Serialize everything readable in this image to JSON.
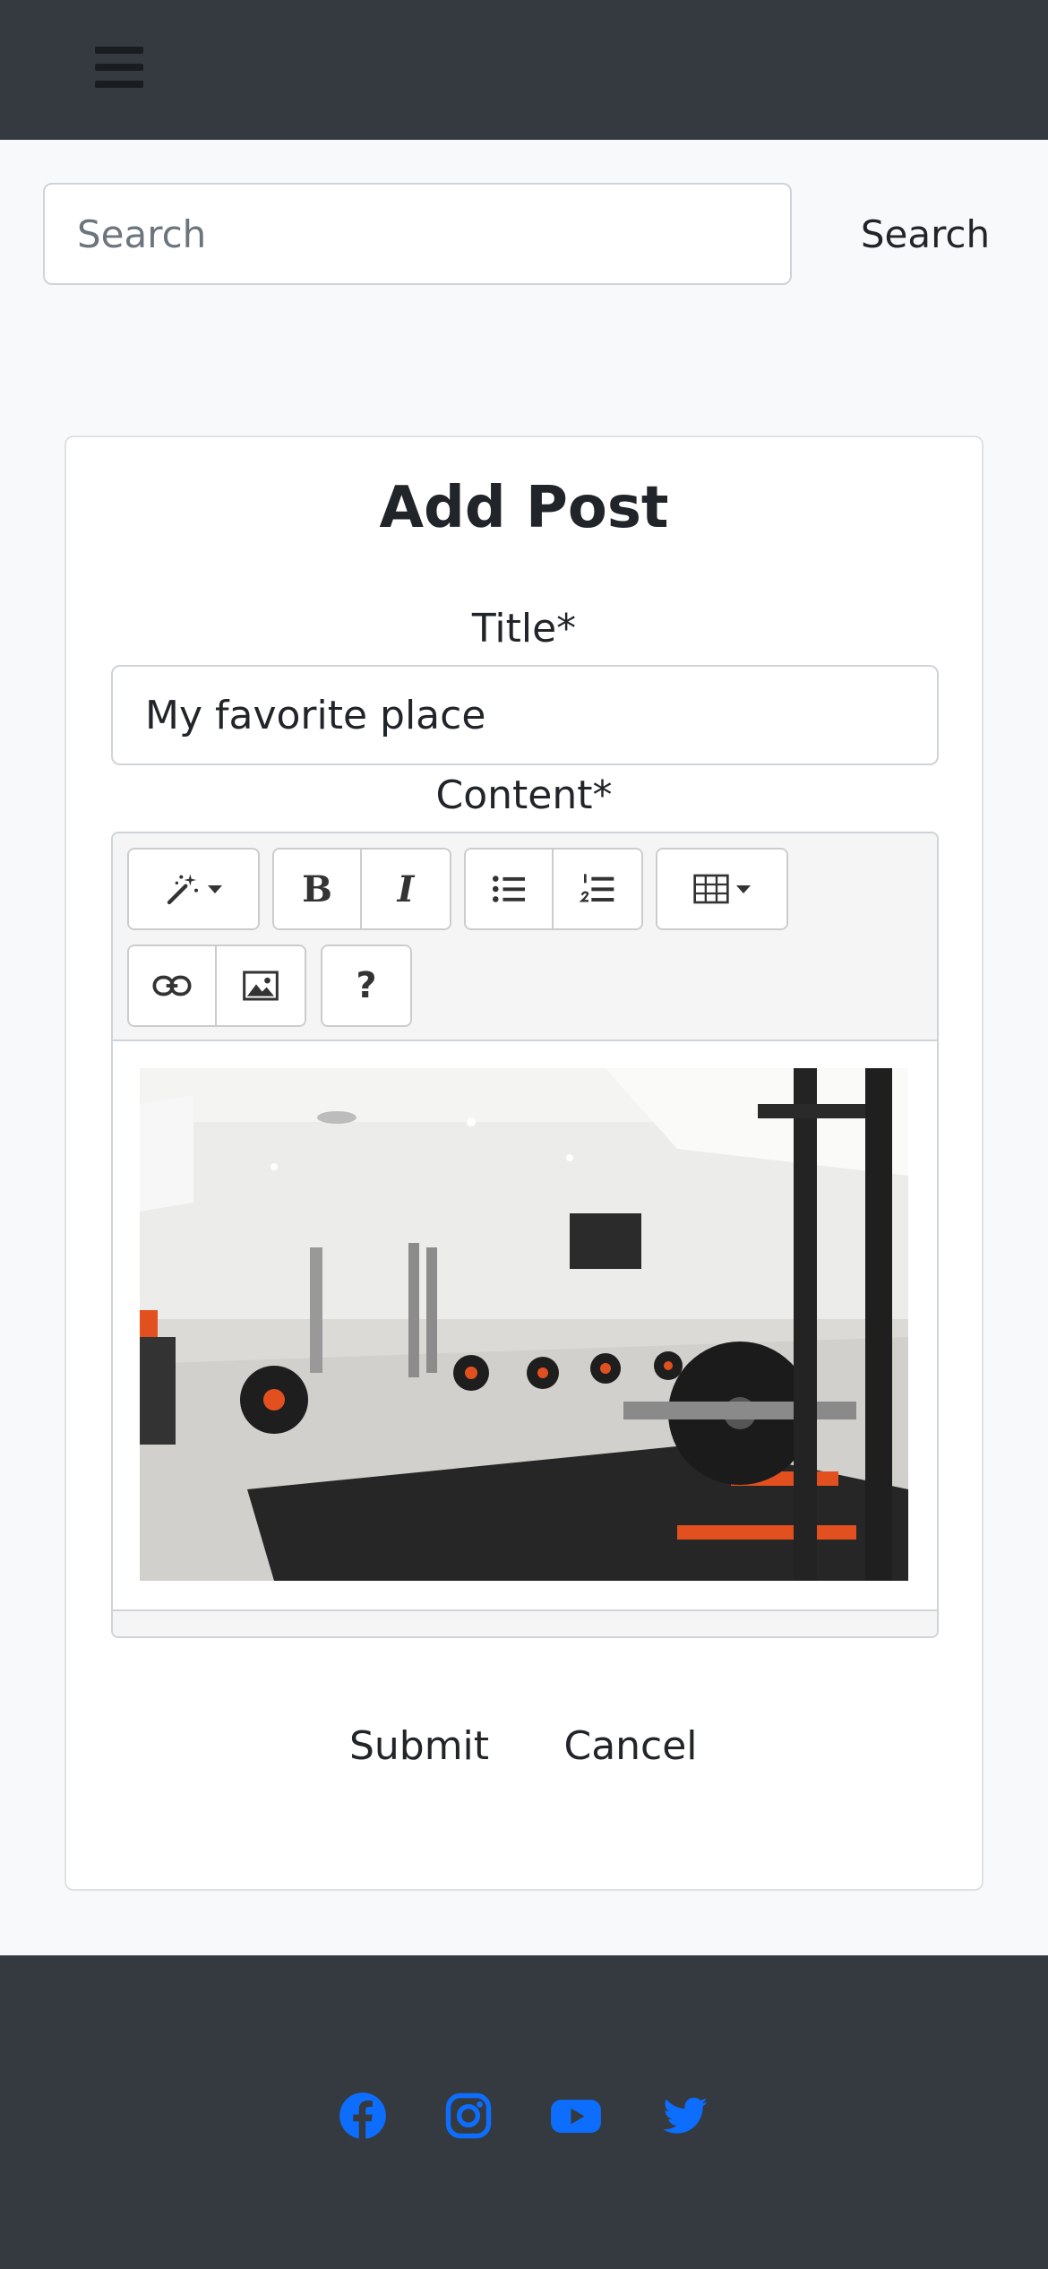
{
  "header": {
    "menu_icon": "hamburger-menu-icon"
  },
  "search": {
    "placeholder": "Search",
    "value": "",
    "button_label": "Search"
  },
  "form": {
    "heading": "Add Post",
    "title_label": "Title*",
    "title_value": "My favorite place",
    "content_label": "Content*",
    "toolbar": {
      "groups": [
        [
          "magic-wand-icon"
        ],
        [
          "bold-icon",
          "italic-icon"
        ],
        [
          "unordered-list-icon",
          "ordered-list-icon"
        ],
        [
          "table-icon"
        ],
        [
          "link-icon",
          "picture-icon"
        ],
        [
          "help-icon"
        ]
      ],
      "bold_glyph": "B",
      "italic_glyph": "I",
      "help_glyph": "?"
    },
    "content_image": "gym-interior-photo",
    "submit_label": "Submit",
    "cancel_label": "Cancel"
  },
  "footer": {
    "social": [
      "facebook-icon",
      "instagram-icon",
      "youtube-icon",
      "twitter-icon"
    ]
  },
  "colors": {
    "navbar_bg": "#343a40",
    "page_bg": "#f8f9fa",
    "social_icon": "#0d6efd"
  }
}
